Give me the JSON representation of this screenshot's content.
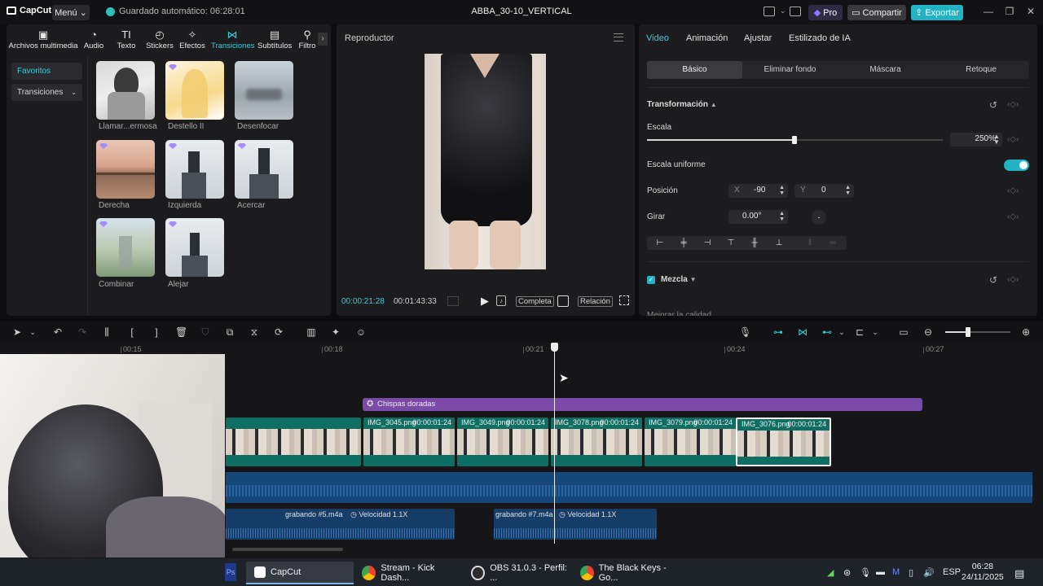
{
  "app": {
    "name": "CapCut",
    "menu_label": "Menú",
    "autosave": "Guardado automático: 06:28:01",
    "project_title": "ABBA_30-10_VERTICAL",
    "pro_label": "Pro",
    "share_label": "Compartir",
    "export_label": "Exportar"
  },
  "categories": [
    {
      "label": "Archivos multimedia",
      "icon": "media-icon"
    },
    {
      "label": "Audio",
      "icon": "audio-icon"
    },
    {
      "label": "Texto",
      "icon": "text-icon"
    },
    {
      "label": "Stickers",
      "icon": "sticker-icon"
    },
    {
      "label": "Efectos",
      "icon": "effects-icon"
    },
    {
      "label": "Transiciones",
      "icon": "transitions-icon",
      "active": true
    },
    {
      "label": "Subtítulos",
      "icon": "subtitles-icon"
    },
    {
      "label": "Filtro",
      "icon": "filter-icon"
    }
  ],
  "sidebar": {
    "items": [
      {
        "label": "Favoritos",
        "active": true
      },
      {
        "label": "Transiciones",
        "active": false
      }
    ]
  },
  "transitions": [
    {
      "label": "Llamar...ermosa"
    },
    {
      "label": "Destello II"
    },
    {
      "label": "Desenfocar"
    },
    {
      "label": "Derecha"
    },
    {
      "label": "Izquierda"
    },
    {
      "label": "Acercar"
    },
    {
      "label": "Combinar"
    },
    {
      "label": "Alejar"
    }
  ],
  "player": {
    "title": "Reproductor",
    "current_time": "00:00:21:28",
    "total_time": "00:01:43:33",
    "full_label": "Completa",
    "ratio_label": "Relación"
  },
  "inspector": {
    "tabs": [
      "Video",
      "Animación",
      "Ajustar",
      "Estilizado de IA"
    ],
    "active_tab": "Video",
    "sub_tabs": [
      "Básico",
      "Eliminar fondo",
      "Máscara",
      "Retoque"
    ],
    "active_sub_tab": "Básico",
    "transform_title": "Transformación",
    "scale_label": "Escala",
    "scale_value": "250%",
    "scale_fraction": 0.5,
    "uniform_scale_label": "Escala uniforme",
    "uniform_scale_on": true,
    "position_label": "Posición",
    "pos_x_label": "X",
    "pos_x": "-90",
    "pos_y_label": "Y",
    "pos_y": "0",
    "rotate_label": "Girar",
    "rotate_value": "0.00°",
    "blend_label": "Mezcla",
    "blend_checked": true,
    "improve_label": "Mejorar la calidad"
  },
  "timeline": {
    "ruler": [
      "00:15",
      "00:18",
      "00:21",
      "00:24",
      "00:27"
    ],
    "effect_clip": "Chispas doradas",
    "video_clips": [
      {
        "name": "",
        "duration": ""
      },
      {
        "name": "IMG_3045.png",
        "duration": "00:00:01:24"
      },
      {
        "name": "IMG_3049.png",
        "duration": "00:00:01:24"
      },
      {
        "name": "IMG_3078.png",
        "duration": "00:00:01:24"
      },
      {
        "name": "IMG_3079.png",
        "duration": "00:00:01:24"
      },
      {
        "name": "IMG_3076.png",
        "duration": "00:00:01:24",
        "selected": true
      }
    ],
    "audio_clips": [
      {
        "name": "grabando #5.m4a",
        "speed": "Velocidad 1.1X"
      },
      {
        "name": "grabando #7.m4a",
        "speed": "Velocidad 1.1X"
      }
    ]
  },
  "taskbar": {
    "items": [
      {
        "label": "CapCut",
        "active": true
      },
      {
        "label": "Stream - Kick Dash...",
        "active": false
      },
      {
        "label": "OBS 31.0.3 - Perfil: ...",
        "active": false
      },
      {
        "label": "The Black Keys - Go...",
        "active": false
      }
    ],
    "lang": "ESP",
    "time": "06:28",
    "date": "24/11/2025"
  },
  "colors": {
    "accent": "#2bd3e0",
    "export": "#21b3c4",
    "effect_clip": "#7b4aa8",
    "video_track": "#0f6e64",
    "audio_track": "#164779"
  }
}
